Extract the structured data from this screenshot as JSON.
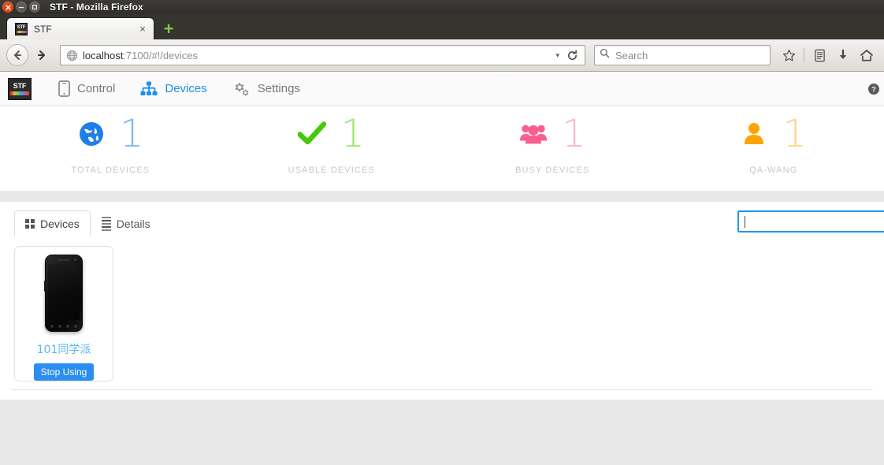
{
  "browser": {
    "window_title": "STF - Mozilla Firefox",
    "window_buttons": {
      "close": "close-icon",
      "minimize": "minimize-icon",
      "maximize": "maximize-icon"
    },
    "tab": {
      "title": "STF",
      "favicon_text": "STF",
      "close_label": "×"
    },
    "new_tab_label": "+",
    "nav": {
      "back": "←",
      "forward": "→",
      "reload": "↻",
      "dropdown_caret": "▾"
    },
    "url": {
      "host": "localhost",
      "rest": ":7100/#!/devices"
    },
    "search": {
      "placeholder": "Search"
    },
    "toolbar_icons": [
      "bookmark-star-icon",
      "reader-list-icon",
      "downloads-icon",
      "home-icon"
    ]
  },
  "app": {
    "logo_text": "STF",
    "nav_items": [
      {
        "label": "Control",
        "icon": "mobile-phone-icon",
        "active": false
      },
      {
        "label": "Devices",
        "icon": "sitemap-icon",
        "active": true
      },
      {
        "label": "Settings",
        "icon": "gears-icon",
        "active": false
      }
    ],
    "help_icon": "help-circle-icon"
  },
  "stats": [
    {
      "label": "TOTAL DEVICES",
      "value": "1",
      "icon": "globe-icon",
      "color": "#1e7fe8"
    },
    {
      "label": "USABLE DEVICES",
      "value": "1",
      "icon": "check-icon",
      "color": "#46c80a"
    },
    {
      "label": "BUSY DEVICES",
      "value": "1",
      "icon": "users-icon",
      "color": "#fb5d8f"
    },
    {
      "label": "QA-WANG",
      "value": "1",
      "icon": "user-icon",
      "color": "#ffa300"
    }
  ],
  "content": {
    "tabs": [
      {
        "label": "Devices",
        "icon": "grid-icon",
        "active": true
      },
      {
        "label": "Details",
        "icon": "list-icon",
        "active": false
      }
    ],
    "search": {
      "value": "",
      "placeholder": ""
    },
    "devices": [
      {
        "name": "101同学派",
        "action_label": "Stop Using",
        "image": "android-phone-image"
      }
    ]
  },
  "colors": {
    "accent_blue": "#1e8ef0",
    "device_name_blue": "#5bb8ef",
    "button_blue": "#2b8ef0",
    "focus_border": "#2196f3"
  }
}
